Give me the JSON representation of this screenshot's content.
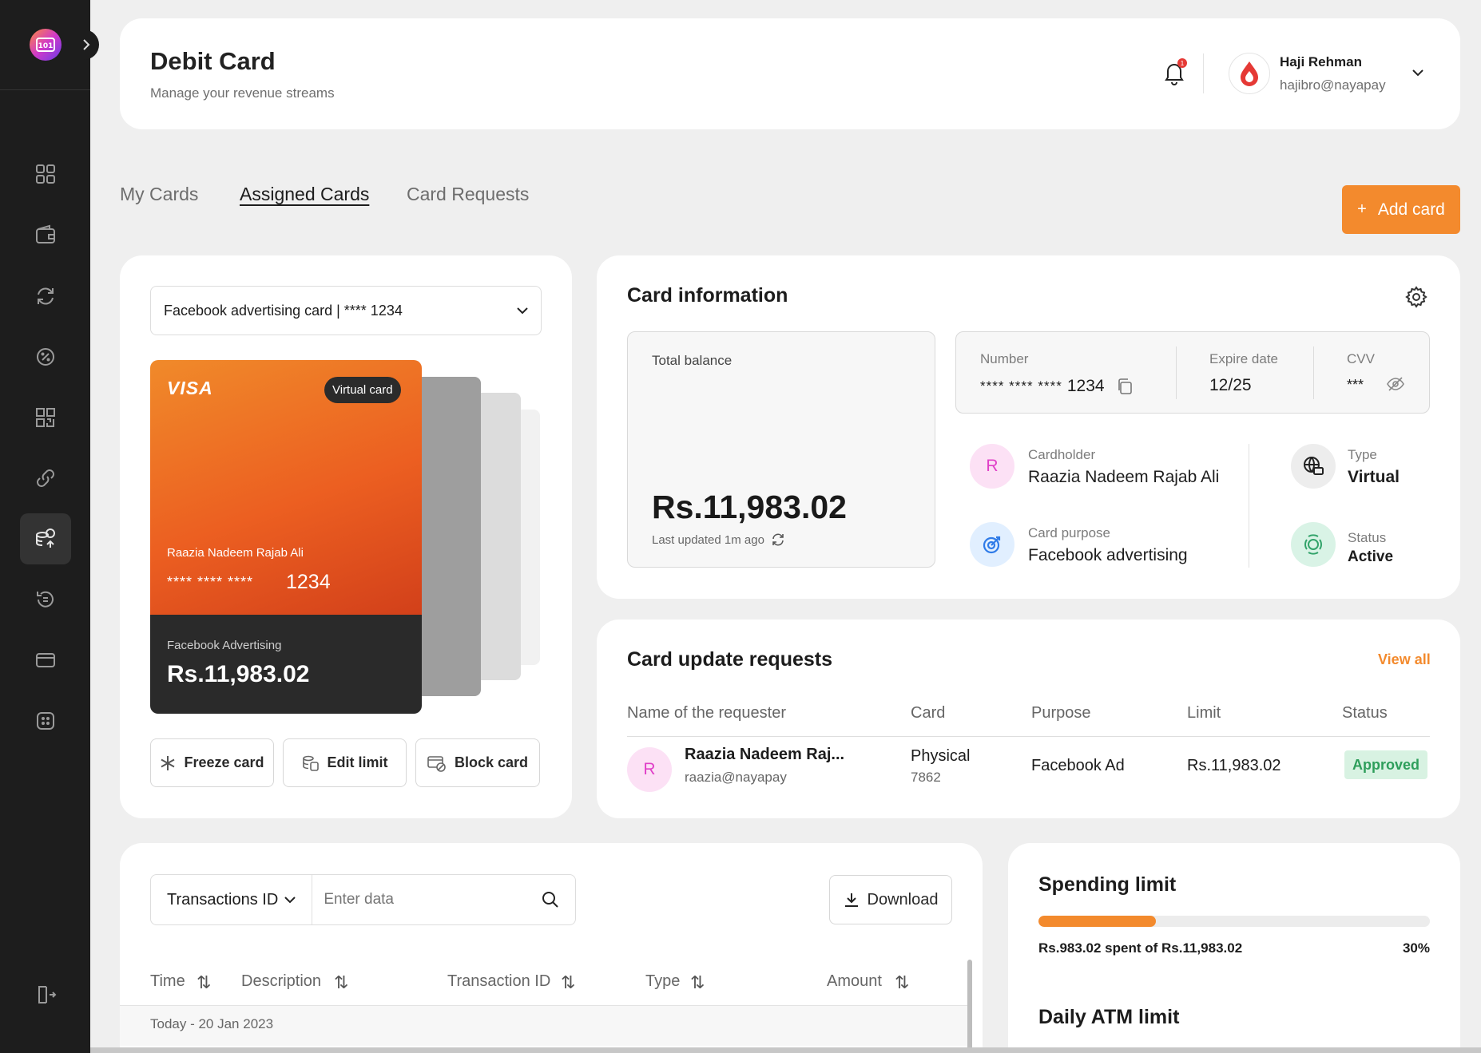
{
  "header": {
    "title": "Debit Card",
    "subtitle": "Manage your revenue streams",
    "notification_count": "1",
    "user": {
      "name": "Haji Rehman",
      "email": "hajibro@nayapay"
    }
  },
  "tabs": [
    {
      "label": "My Cards"
    },
    {
      "label": "Assigned Cards"
    },
    {
      "label": "Card Requests"
    }
  ],
  "add_card_label": "Add card",
  "card_selector": {
    "value": "Facebook advertising card | **** 1234"
  },
  "visual_card": {
    "brand": "VISA",
    "badge": "Virtual card",
    "holder": "Raazia Nadeem Rajab Ali",
    "number_masked": "**** **** ****",
    "number_last": "1234",
    "footer_label": "Facebook Advertising",
    "footer_balance": "Rs.11,983.02"
  },
  "card_actions": {
    "freeze": "Freeze card",
    "edit_limit": "Edit limit",
    "block": "Block card"
  },
  "card_info": {
    "title": "Card information",
    "total_balance_label": "Total balance",
    "total_balance": "Rs.11,983.02",
    "last_updated": "Last updated 1m ago",
    "number_label": "Number",
    "number_masked": "**** **** ****",
    "number_last": "1234",
    "expire_label": "Expire date",
    "expire_value": "12/25",
    "cvv_label": "CVV",
    "cvv_value": "***",
    "cardholder_label": "Cardholder",
    "cardholder_value": "Raazia Nadeem Rajab Ali",
    "cardholder_initial": "R",
    "purpose_label": "Card purpose",
    "purpose_value": "Facebook advertising",
    "type_label": "Type",
    "type_value": "Virtual",
    "status_label": "Status",
    "status_value": "Active"
  },
  "update_requests": {
    "title": "Card update requests",
    "view_all": "View all",
    "columns": [
      "Name of the requester",
      "Card",
      "Purpose",
      "Limit",
      "Status"
    ],
    "rows": [
      {
        "initial": "R",
        "name": "Raazia Nadeem Raj...",
        "email": "raazia@nayapay",
        "card": "Physical",
        "card_number": "7862",
        "purpose": "Facebook Ad",
        "limit": "Rs.11,983.02",
        "status": "Approved"
      }
    ]
  },
  "transactions": {
    "filter_label": "Transactions ID",
    "search_placeholder": "Enter data",
    "download_label": "Download",
    "columns": [
      "Time",
      "Description",
      "Transaction ID",
      "Type",
      "Amount"
    ],
    "group_label": "Today - 20 Jan 2023"
  },
  "spending": {
    "title": "Spending limit",
    "spent_text": "Rs.983.02 spent of Rs.11,983.02",
    "percent_text": "30%",
    "progress_fraction": 0.3,
    "daily_atm_title": "Daily ATM limit"
  },
  "colors": {
    "accent": "#f38a2d",
    "sidebar": "#1d1d1d",
    "approved_bg": "#d8f2e2",
    "approved_text": "#2e9e5b"
  }
}
